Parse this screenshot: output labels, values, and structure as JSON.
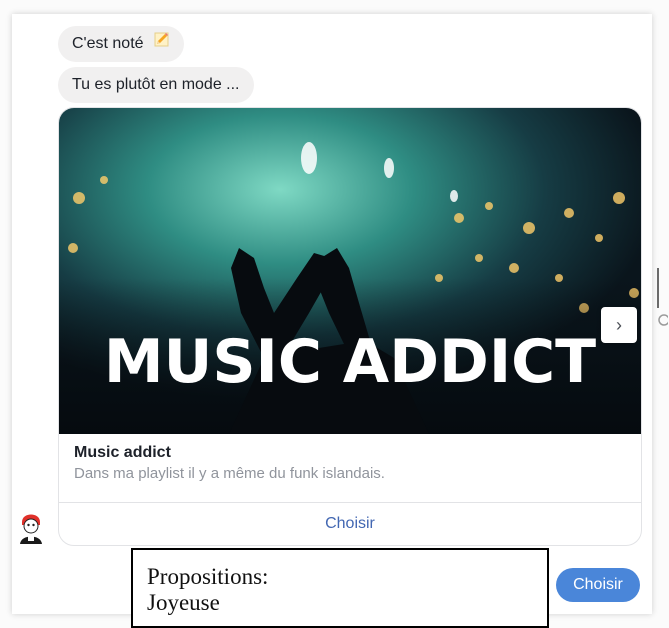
{
  "messages": {
    "first": "C'est noté",
    "second": "Tu es plutôt en mode ..."
  },
  "card": {
    "image_caption": "MUSIC ADDICT",
    "title": "Music addict",
    "subtitle": "Dans ma playlist il y a même du funk islandais.",
    "button_label": "Choisir",
    "next_glyph": "›"
  },
  "propositions": {
    "heading": "Propositions:",
    "first_item": "Joyeuse"
  },
  "quick_reply": {
    "label": "Choisir"
  },
  "icons": {
    "pencil": "pencil-icon",
    "next": "chevron-right-icon",
    "avatar": "bot-avatar"
  },
  "colors": {
    "bubble": "#f1f0f0",
    "link": "#4267b2",
    "quick_reply": "#4a86d9"
  }
}
